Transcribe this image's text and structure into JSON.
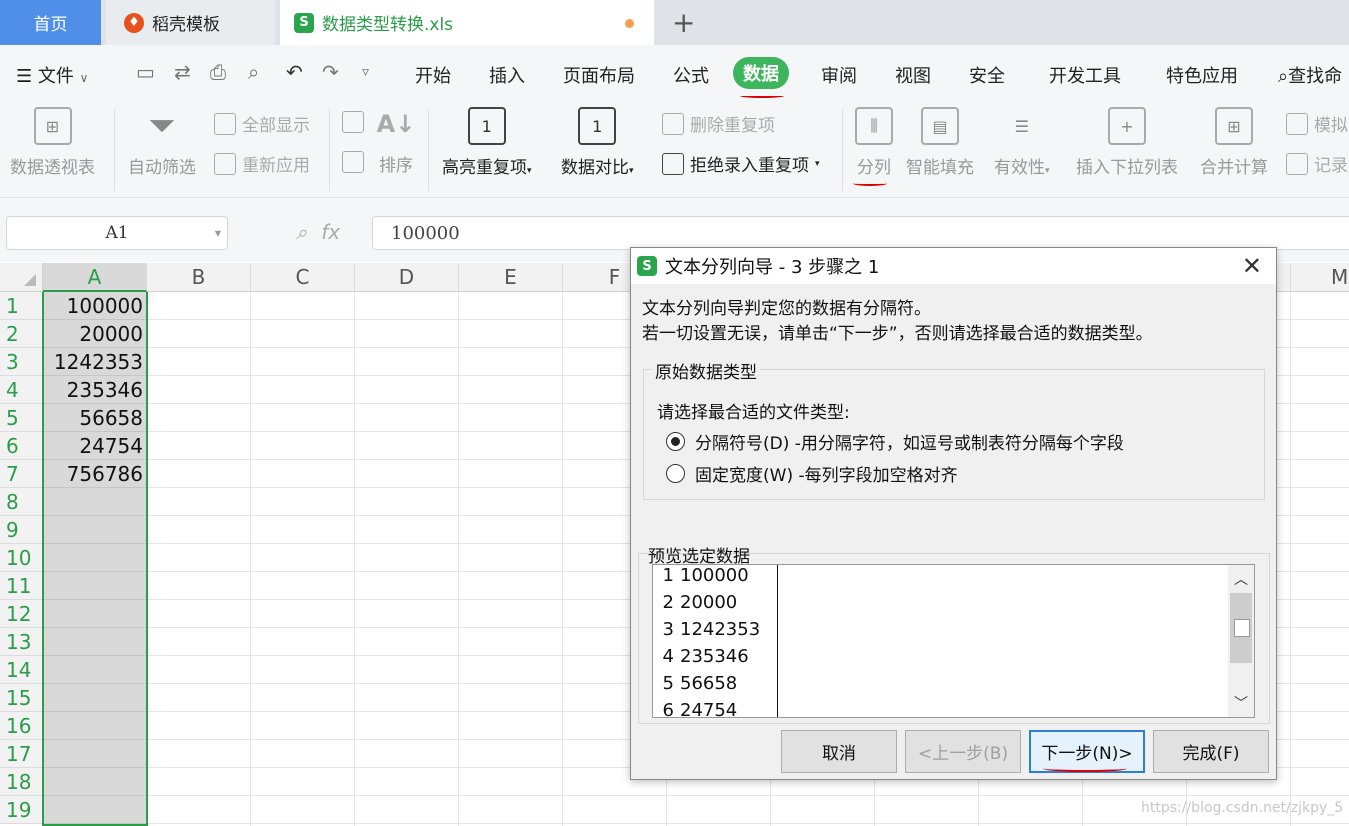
{
  "tabs": {
    "home": "首页",
    "docer": "稻壳模板",
    "file": "数据类型转换.xls",
    "new_tab": "+"
  },
  "menu": {
    "file": "文件",
    "items": [
      "开始",
      "插入",
      "页面布局",
      "公式",
      "数据",
      "审阅",
      "视图",
      "安全",
      "开发工具",
      "特色应用"
    ],
    "active": "数据",
    "search": "查找命"
  },
  "ribbon": {
    "pivot": "数据透视表",
    "autofilter": "自动筛选",
    "show_all": "全部显示",
    "reapply": "重新应用",
    "sort": "排序",
    "highlight_dup": "高亮重复项",
    "compare": "数据对比",
    "remove_dup": "删除重复项",
    "reject_dup": "拒绝录入重复项",
    "split": "分列",
    "smart_fill": "智能填充",
    "validity": "有效性",
    "insert_dropdown": "插入下拉列表",
    "consolidate": "合并计算",
    "simulate": "模拟",
    "record": "记录"
  },
  "formula_bar": {
    "name_box": "A1",
    "fx": "fx",
    "value": "100000"
  },
  "columns": [
    "A",
    "B",
    "C",
    "D",
    "E",
    "F",
    "M"
  ],
  "rows": [
    "1",
    "2",
    "3",
    "4",
    "5",
    "6",
    "7",
    "8",
    "9",
    "10",
    "11",
    "12",
    "13",
    "14",
    "15",
    "16",
    "17",
    "18",
    "19"
  ],
  "cells_a": [
    "100000",
    "20000",
    "1242353",
    "235346",
    "56658",
    "24754",
    "756786"
  ],
  "dialog": {
    "title": "文本分列向导 - 3 步骤之 1",
    "line1": "文本分列向导判定您的数据有分隔符。",
    "line2": "若一切设置无误，请单击“下一步”，否则请选择最合适的数据类型。",
    "group_label": "原始数据类型",
    "prompt": "请选择最合适的文件类型:",
    "radio_delimited": "分隔符号(D)   -用分隔字符，如逗号或制表符分隔每个字段",
    "radio_fixed": "固定宽度(W)   -每列字段加空格对齐",
    "selected": "delimited",
    "preview_label": "预览选定数据",
    "preview_rows": [
      {
        "n": "1",
        "v": "100000"
      },
      {
        "n": "2",
        "v": "20000"
      },
      {
        "n": "3",
        "v": "1242353"
      },
      {
        "n": "4",
        "v": "235346"
      },
      {
        "n": "5",
        "v": "56658"
      },
      {
        "n": "6",
        "v": "24754"
      }
    ],
    "btn_cancel": "取消",
    "btn_back": "<上一步(B)",
    "btn_next": "下一步(N)>",
    "btn_finish": "完成(F)"
  },
  "watermark": "https://blog.csdn.net/zjkpy_5",
  "colors": {
    "accent_green": "#3cb55c",
    "home_tab_blue": "#4f8ee9",
    "annotation_red": "#dd0000"
  }
}
